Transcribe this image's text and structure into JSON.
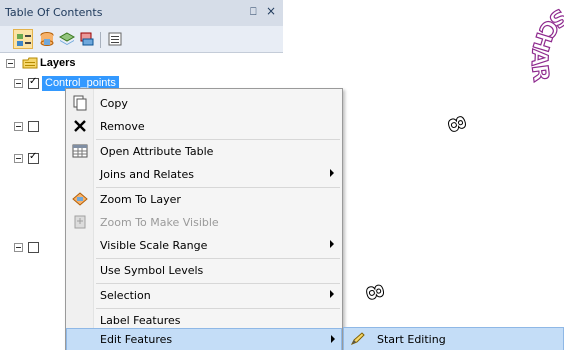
{
  "toc": {
    "title": "Table Of Contents",
    "pin_glyph": "ѱ",
    "close_glyph": "×",
    "toolbar": [
      "list-by-drawing-order",
      "list-by-source",
      "list-by-visibility",
      "list-by-selection",
      "options"
    ]
  },
  "tree": {
    "root_label": "Layers",
    "selected_layer": "Control_points"
  },
  "context_menu": {
    "items": [
      {
        "label": "Copy",
        "icon": "copy-icon"
      },
      {
        "label": "Remove",
        "icon": "remove-icon"
      },
      {
        "label": "Open Attribute Table",
        "icon": "table-icon"
      },
      {
        "label": "Joins and Relates",
        "submenu": true
      },
      {
        "label": "Zoom To Layer",
        "icon": "zoom-layer-icon"
      },
      {
        "label": "Zoom To Make Visible",
        "icon": "zoom-visible-icon",
        "disabled": true
      },
      {
        "label": "Visible Scale Range",
        "submenu": true
      },
      {
        "label": "Use Symbol Levels"
      },
      {
        "label": "Selection",
        "submenu": true
      },
      {
        "label": "Label Features"
      },
      {
        "label": "Edit Features",
        "submenu": true,
        "highlighted": true
      }
    ]
  },
  "submenu": {
    "label": "Start Editing",
    "icon": "pencil-icon"
  },
  "map": {
    "label_1": "8",
    "label_2": "8",
    "curved_text": "SCHAR"
  },
  "colors": {
    "selection": "#3399ff",
    "menu_highlight": "#c4ddf7",
    "toc_background": "#dde4ee"
  }
}
